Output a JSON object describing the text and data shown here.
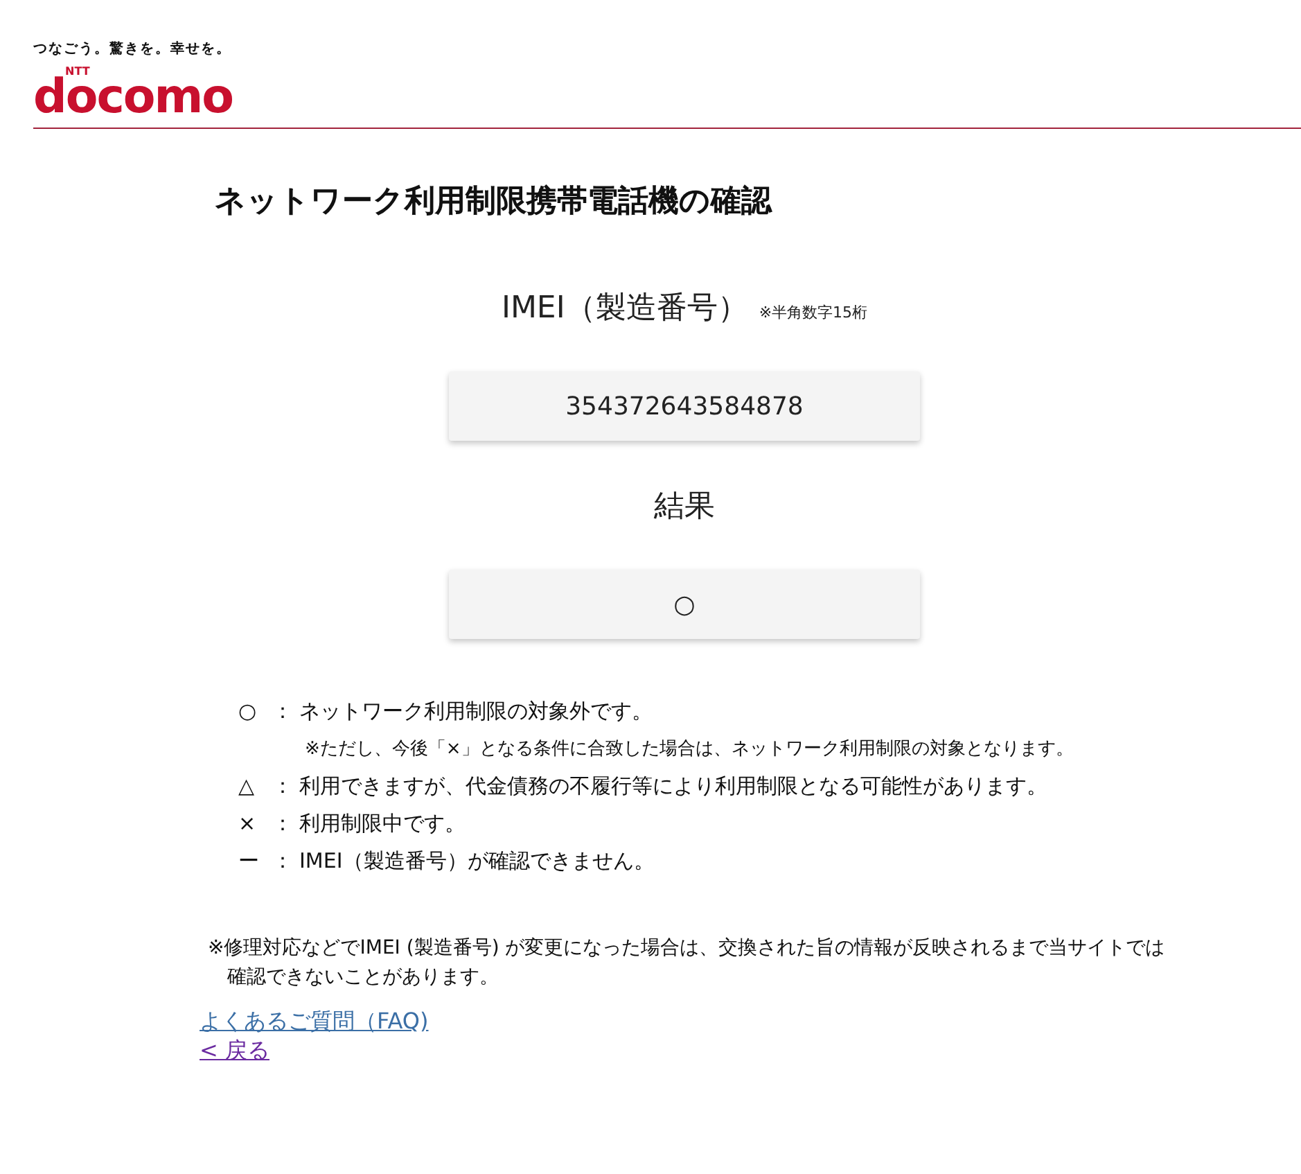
{
  "header": {
    "tagline": "つなごう。驚きを。幸せを。",
    "logo_small": "NTT",
    "logo": "docomo"
  },
  "title": "ネットワーク利用制限携帯電話機の確認",
  "imei": {
    "label": "IMEI（製造番号）",
    "note": "※半角数字15桁",
    "value": "354372643584878"
  },
  "result": {
    "label": "結果",
    "value": "○"
  },
  "legend": [
    {
      "symbol": "○",
      "separator": "：",
      "text": "ネットワーク利用制限の対象外です。",
      "note": "※ただし、今後「×」となる条件に合致した場合は、ネットワーク利用制限の対象となります。"
    },
    {
      "symbol": "△",
      "separator": "：",
      "text": "利用できますが、代金債務の不履行等により利用制限となる可能性があります。"
    },
    {
      "symbol": "×",
      "separator": "：",
      "text": "利用制限中です。"
    },
    {
      "symbol": "ー",
      "separator": "：",
      "text": "IMEI（製造番号）が確認できません。"
    }
  ],
  "footnote": "※修理対応などでIMEI (製造番号) が変更になった場合は、交換された旨の情報が反映されるまで当サイトでは確認できないことがあります。",
  "links": [
    {
      "label": "よくあるご質問（FAQ)",
      "visited": false
    },
    {
      "label": "< 戻る",
      "visited": true
    }
  ]
}
